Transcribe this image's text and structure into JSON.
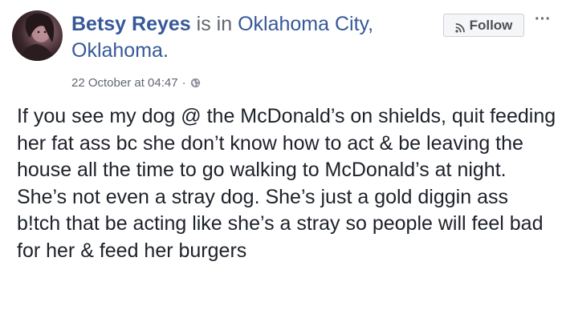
{
  "post": {
    "author": "Betsy Reyes",
    "is_in": " is in ",
    "location": "Oklahoma City, Oklahoma.",
    "date": "22 October at 04:47",
    "separator": "·",
    "privacy_icon": "globe-icon",
    "follow_label": "Follow",
    "follow_icon": "rss-icon",
    "more_label": "···",
    "body": "If you see my dog @ the McDonald’s on shields, quit feeding her fat ass bc she don’t know how to act & be leaving the house all the time to go walking to McDonald’s at night. She’s not even a stray dog. She’s just a gold diggin ass b!tch that be acting like she’s a stray so people will feel bad for her & feed her burgers"
  },
  "colors": {
    "link": "#365899",
    "meta": "#616770",
    "text": "#1d2129",
    "button_bg": "#f5f6f7",
    "button_border": "#ccd0d5"
  }
}
